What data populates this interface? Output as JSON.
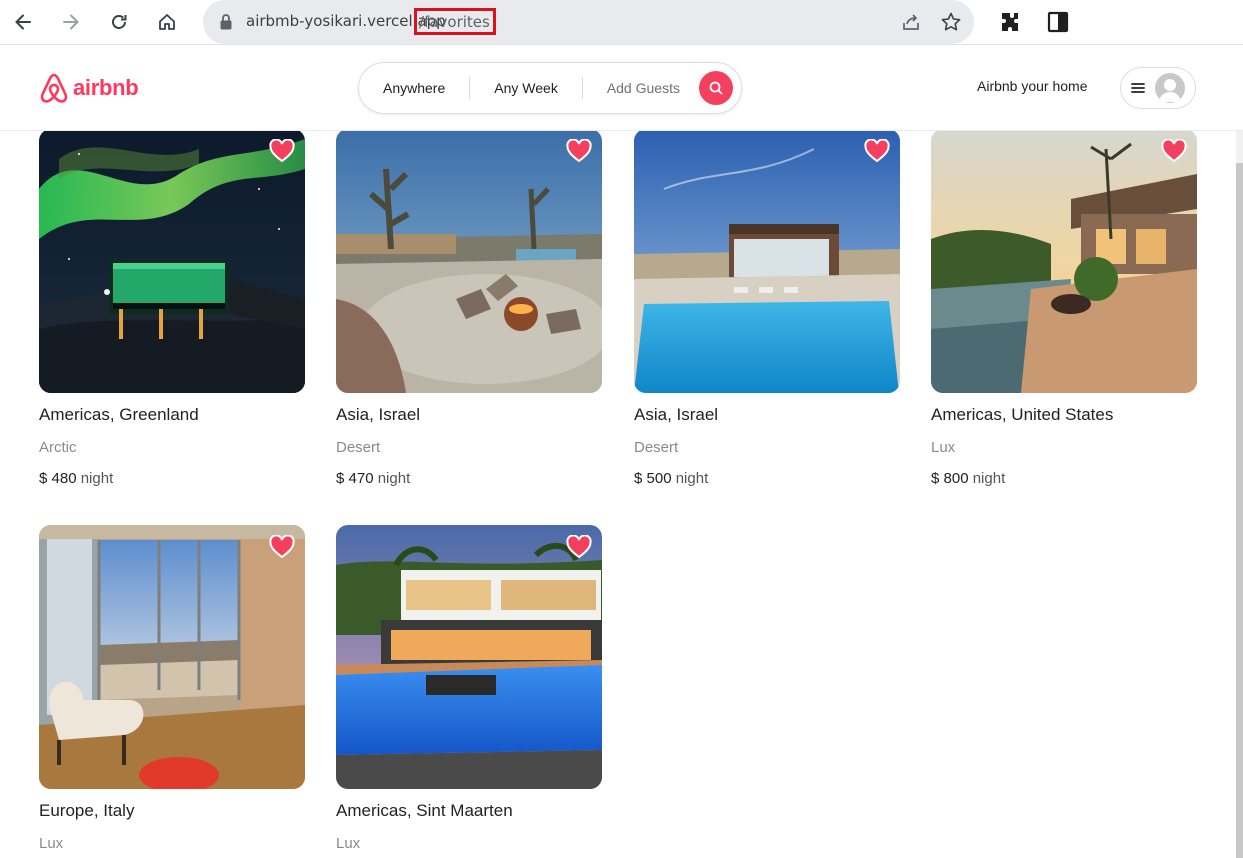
{
  "browser": {
    "url_host": "airbmb-yosikari.vercel.app",
    "url_path": "/favorites"
  },
  "header": {
    "logo_text": "airbnb",
    "search": {
      "where": "Anywhere",
      "when": "Any Week",
      "guests": "Add Guests"
    },
    "host_link": "Airbnb your home"
  },
  "colors": {
    "brand": "#ff385c",
    "search_button": "#f43f5e",
    "favorite_heart": "#f43f5e"
  },
  "listings": [
    {
      "location": "Americas, Greenland",
      "category": "Arctic",
      "price": "$ 480",
      "unit": "night",
      "favorited": true
    },
    {
      "location": "Asia, Israel",
      "category": "Desert",
      "price": "$ 470",
      "unit": "night",
      "favorited": true
    },
    {
      "location": "Asia, Israel",
      "category": "Desert",
      "price": "$ 500",
      "unit": "night",
      "favorited": true
    },
    {
      "location": "Americas, United States",
      "category": "Lux",
      "price": "$ 800",
      "unit": "night",
      "favorited": true
    },
    {
      "location": "Europe, Italy",
      "category": "Lux",
      "price": "",
      "unit": "",
      "favorited": true
    },
    {
      "location": "Americas, Sint Maarten",
      "category": "Lux",
      "price": "",
      "unit": "",
      "favorited": true
    }
  ]
}
